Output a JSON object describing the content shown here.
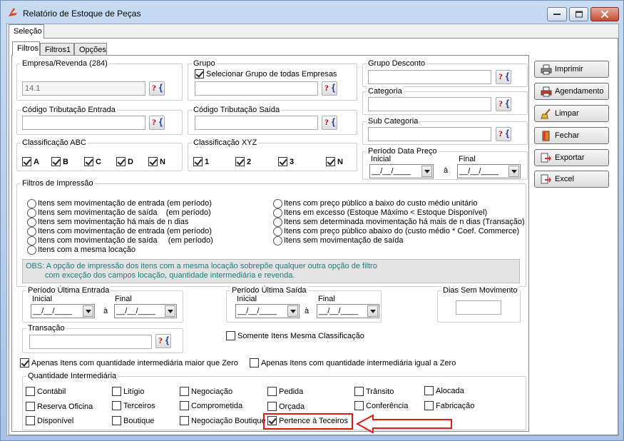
{
  "window": {
    "title": "Relatório de Estoque de Peças"
  },
  "outer_tab": "Seleção",
  "tabs": [
    "Filtros",
    "Filtros1",
    "Opções"
  ],
  "empresa": {
    "label": "Empresa/Revenda (284)",
    "value": "14.1"
  },
  "grupo": {
    "label": "Grupo",
    "check_all": "Selecionar Grupo de todas Empresas"
  },
  "grupo_desconto": {
    "label": "Grupo Desconto"
  },
  "categoria": {
    "label": "Categoria"
  },
  "sub_categoria": {
    "label": "Sub Categoria"
  },
  "trib_entrada": {
    "label": "Código Tributação Entrada"
  },
  "trib_saida": {
    "label": "Código Tributação Saída"
  },
  "abc": {
    "label": "Classificação ABC",
    "items": [
      "A",
      "B",
      "C",
      "D",
      "N"
    ]
  },
  "xyz": {
    "label": "Classificação XYZ",
    "items": [
      "1",
      "2",
      "3",
      "N"
    ]
  },
  "periodo_preco": {
    "label": "Período Data Preço",
    "inicial": "Inicial",
    "final": "Final",
    "a": "à",
    "placeholder": "__/__/____"
  },
  "filtros_impressao": {
    "label": "Filtros de Impressão",
    "left": [
      "Itens sem movimentação de entrada (em período)",
      "Itens sem movimentação de saída    (em período)",
      "Itens sem movimentação há mais de n dias",
      "Itens com movimentação de entrada (em período)",
      "Itens com movimentação de saída     (em período)",
      "Itens com a mesma locação"
    ],
    "right": [
      "Itens com preço público a baixo do custo médio unitário",
      "Itens em excesso (Estoque Máximo < Estoque Disponível)",
      "Itens sem determinada movimentação há mais de n dias (Transação)",
      "Itens com preço público abaixo do (custo médio * Coef. Commerce)",
      "Itens sem movimentação de saída"
    ]
  },
  "obs": {
    "line1": "OBS: A opção de impressão dos itens com a mesma locação sobrepõe qualquer outra opção de filtro",
    "line2": "com exceção dos campos locação,  quantidade intermediária e revenda."
  },
  "ultima_entrada": {
    "label": "Período Última Entrada",
    "inicial": "Inicial",
    "final": "Final",
    "a": "à",
    "placeholder": "__/__/____"
  },
  "ultima_saida": {
    "label": "Período Última Saída",
    "inicial": "Inicial",
    "final": "Final",
    "a": "à",
    "placeholder": "__/__/____"
  },
  "dias_sem_mov": {
    "label": "Dias Sem Movimento"
  },
  "transacao": {
    "label": "Transação"
  },
  "mesma_classificacao": "Somente Itens Mesma Classificação",
  "qtd_maior_zero": "Apenas Itens com quantidade intermediária maior que Zero",
  "qtd_igual_zero": "Apenas Itens com quantidade intermediária igual a  Zero",
  "qtd_inter": {
    "label": "Quantidade Intermediária",
    "rows": [
      [
        "Contábil",
        "Litígio",
        "Negociação",
        "Pedida",
        "Trânsito",
        "Alocada"
      ],
      [
        "Reserva Oficina",
        "Terceiros",
        "Comprometida",
        "Orçada",
        "Conferência",
        "Fabricação"
      ],
      [
        "Disponível",
        "Boutique",
        "Negociação Boutique",
        "Pertence à Teceiros"
      ]
    ]
  },
  "buttons": [
    "Imprimir",
    "Agendamento",
    "Limpar",
    "Fechar",
    "Exportar",
    "Excel"
  ],
  "colors": {
    "highlight": "#e31919",
    "obs_text": "#1a7d7d"
  }
}
